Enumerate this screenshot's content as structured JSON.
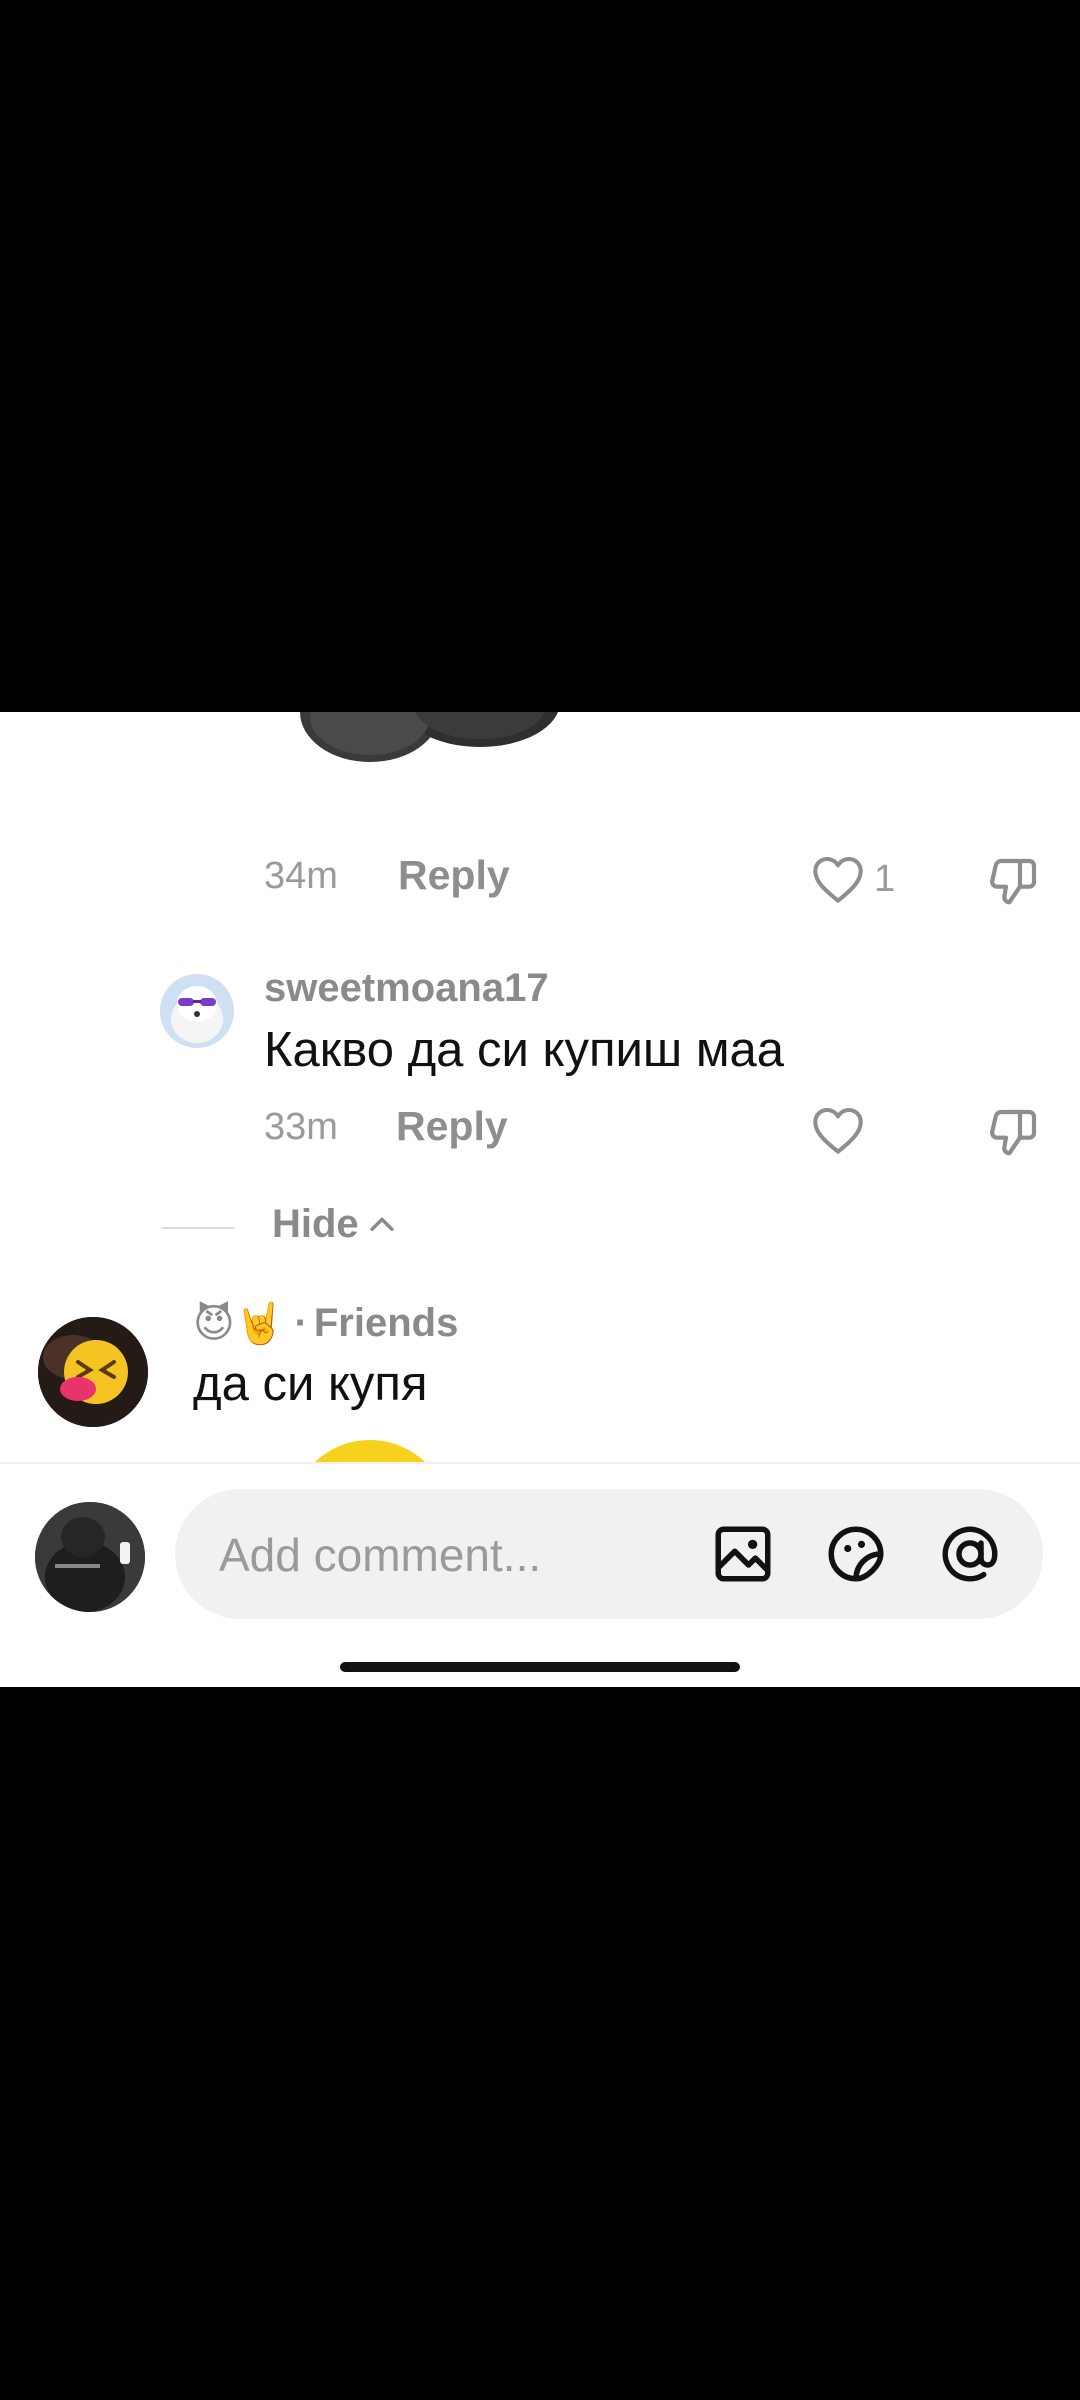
{
  "comments": [
    {
      "time": "34m",
      "reply": "Reply",
      "likes": "1"
    },
    {
      "username": "sweetmoana17",
      "text": "Какво да си купиш маа",
      "time": "33m",
      "reply": "Reply"
    }
  ],
  "hide_label": "Hide",
  "friend_comment": {
    "username_emoji": "😈🤘",
    "separator": "·",
    "tag": "Friends",
    "text": "да си купя"
  },
  "composer": {
    "placeholder": "Add comment...",
    "icons": [
      "image-icon",
      "sticker-icon",
      "mention-icon"
    ]
  },
  "colors": {
    "panel_bg": "#ffffff",
    "meta_gray": "#8e8e8e",
    "text": "#111111",
    "pill_bg": "#f1f1f2"
  }
}
